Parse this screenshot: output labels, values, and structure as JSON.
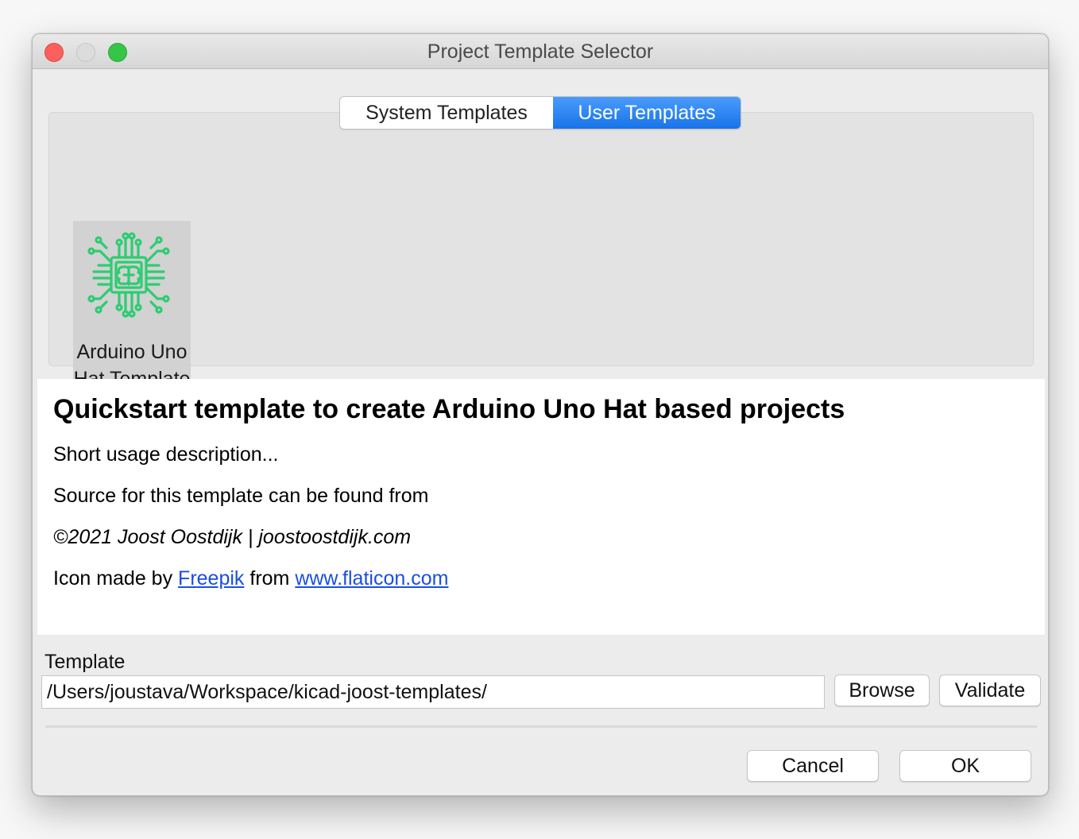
{
  "window": {
    "title": "Project Template Selector"
  },
  "tabs": [
    {
      "label": "System Templates",
      "selected": false
    },
    {
      "label": "User Templates",
      "selected": true
    }
  ],
  "templates": [
    {
      "name": "Arduino Uno Hat Template",
      "icon": "circuit-brain-icon",
      "icon_color": "#2ecc71"
    }
  ],
  "description": {
    "heading": "Quickstart template to create Arduino Uno Hat based projects",
    "usage": "Short usage description...",
    "source": "Source for this template can be found from",
    "copyright": "©2021 Joost Oostdijk | joostoostdijk.com",
    "credit_prefix": "Icon made by",
    "credit_author": "Freepik",
    "credit_middle": "from",
    "credit_site": "www.flaticon.com",
    "link_color": "#1a4fe0"
  },
  "template_path": {
    "label": "Template",
    "value": "/Users/joustava/Workspace/kicad-joost-templates/"
  },
  "buttons": {
    "browse": "Browse",
    "validate": "Validate",
    "cancel": "Cancel",
    "ok": "OK"
  },
  "colors": {
    "selected_tab": "#1874ea",
    "close": "#fc605c",
    "maximize": "#35c648"
  }
}
